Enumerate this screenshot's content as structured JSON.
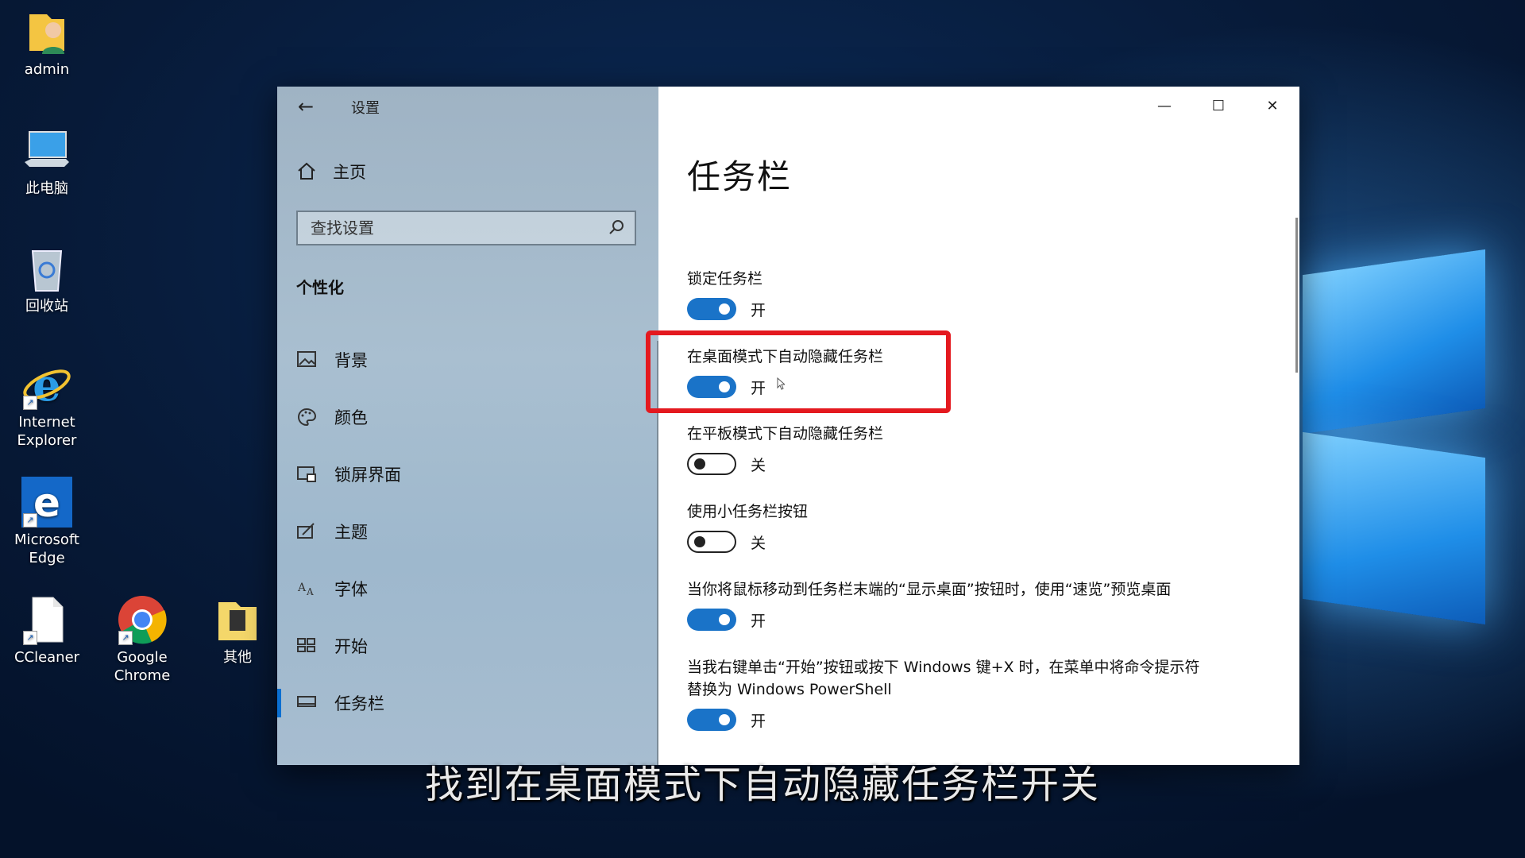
{
  "desktop": {
    "icons": [
      {
        "label": "admin",
        "icon": "user-folder-icon"
      },
      {
        "label": "此电脑",
        "icon": "computer-icon"
      },
      {
        "label": "回收站",
        "icon": "recycle-bin-icon"
      },
      {
        "label": "Internet\nExplorer",
        "icon": "ie-icon"
      },
      {
        "label": "Microsoft\nEdge",
        "icon": "edge-icon"
      },
      {
        "label": "CCleaner",
        "icon": "file-icon"
      },
      {
        "label": "Google\nChrome",
        "icon": "chrome-icon"
      },
      {
        "label": "其他",
        "icon": "folder-icon"
      }
    ]
  },
  "window": {
    "title": "设置",
    "home": "主页",
    "search_placeholder": "查找设置",
    "section": "个性化",
    "nav": [
      {
        "label": "背景",
        "icon": "picture-icon"
      },
      {
        "label": "颜色",
        "icon": "palette-icon"
      },
      {
        "label": "锁屏界面",
        "icon": "lock-screen-icon"
      },
      {
        "label": "主题",
        "icon": "theme-icon"
      },
      {
        "label": "字体",
        "icon": "font-icon"
      },
      {
        "label": "开始",
        "icon": "start-icon"
      },
      {
        "label": "任务栏",
        "icon": "taskbar-icon",
        "active": true
      }
    ]
  },
  "main": {
    "title": "任务栏",
    "settings": [
      {
        "label": "锁定任务栏",
        "state": "开",
        "on": true
      },
      {
        "label": "在桌面模式下自动隐藏任务栏",
        "state": "开",
        "on": true
      },
      {
        "label": "在平板模式下自动隐藏任务栏",
        "state": "关",
        "on": false
      },
      {
        "label": "使用小任务栏按钮",
        "state": "关",
        "on": false
      },
      {
        "label": "当你将鼠标移动到任务栏末端的“显示桌面”按钮时，使用“速览”预览桌面",
        "state": "开",
        "on": true
      },
      {
        "label": "当我右键单击“开始”按钮或按下 Windows 键+X 时，在菜单中将命令提示符替换为 Windows PowerShell",
        "state": "开",
        "on": true
      }
    ]
  },
  "subtitle": "找到在桌面模式下自动隐藏任务栏开关",
  "colors": {
    "accent": "#1a73c8",
    "highlight": "#e4191f"
  }
}
